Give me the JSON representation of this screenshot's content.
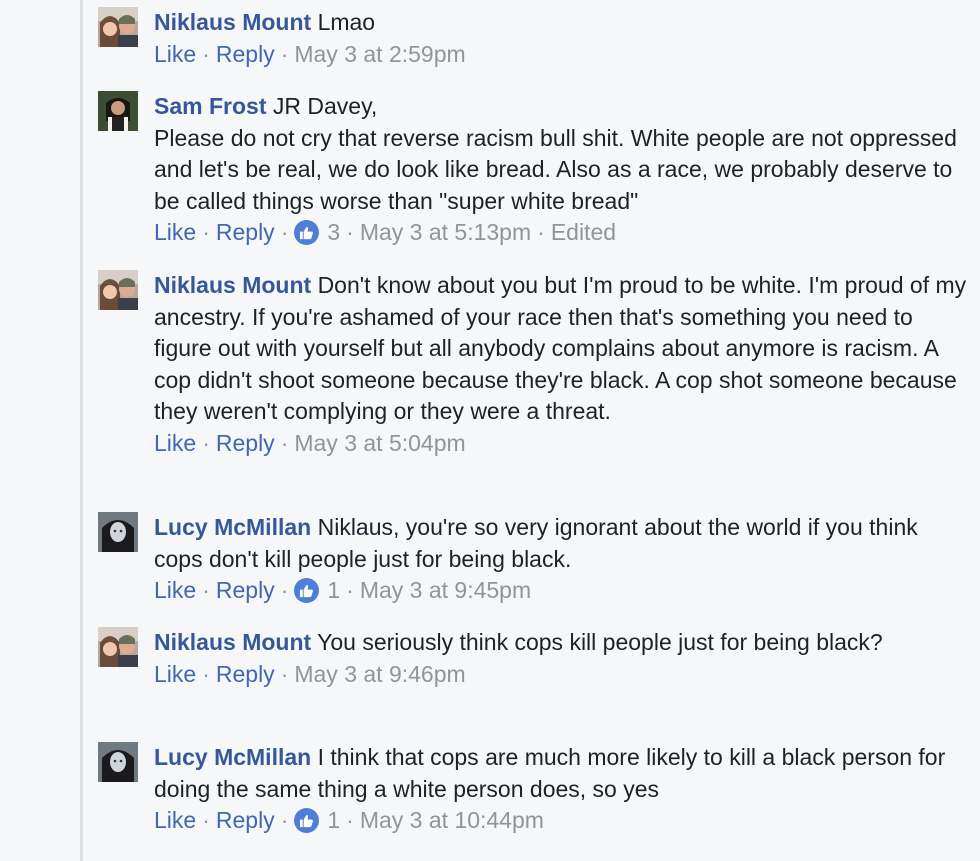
{
  "labels": {
    "like": "Like",
    "reply": "Reply",
    "separator": "·"
  },
  "colors": {
    "author": "#365899",
    "action_link": "#4267b2",
    "meta": "#90949c",
    "like_badge": "#4e7ed8",
    "background": "#f6f7f9"
  },
  "icons": {
    "avatar": "profile-photo",
    "reaction": "thumbs-up-icon"
  },
  "comments": [
    {
      "author": "Niklaus Mount",
      "text": "Lmao",
      "likes": "",
      "timestamp": "May 3 at 2:59pm",
      "edited": ""
    },
    {
      "author": "Sam Frost",
      "text": "JR Davey,\nPlease do not cry that reverse racism bull shit. White people are not oppressed and let's be real, we do look like bread. Also as a race, we probably deserve to be called things worse than \"super white bread\"",
      "likes": "3",
      "timestamp": "May 3 at 5:13pm",
      "edited": "Edited"
    },
    {
      "author": "Niklaus Mount",
      "text": "Don't know about you but I'm proud to be white. I'm proud of my ancestry. If you're ashamed of your race then that's something you need to figure out with yourself but all anybody complains about anymore is racism. A cop didn't shoot someone because they're black. A cop shot someone because they weren't complying or they were a threat.",
      "likes": "",
      "timestamp": "May 3 at 5:04pm",
      "edited": ""
    },
    {
      "author": "Lucy McMillan",
      "text": "Niklaus, you're so very ignorant about the world if you think cops don't kill people just for being black.",
      "likes": "1",
      "timestamp": "May 3 at 9:45pm",
      "edited": ""
    },
    {
      "author": "Niklaus Mount",
      "text": "You seriously think cops kill people just for being black?",
      "likes": "",
      "timestamp": "May 3 at 9:46pm",
      "edited": ""
    },
    {
      "author": "Lucy McMillan",
      "text": "I think that cops are much more likely to kill a black person for doing the same thing a white person does, so yes",
      "likes": "1",
      "timestamp": "May 3 at 10:44pm",
      "edited": ""
    }
  ]
}
